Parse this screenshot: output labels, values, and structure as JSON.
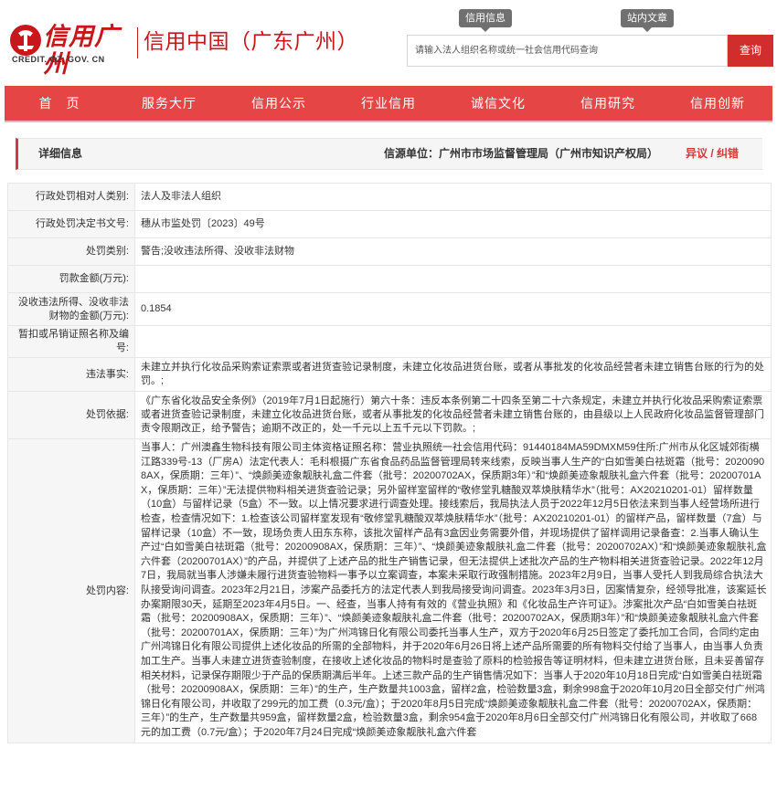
{
  "header": {
    "logo_cn": "信用广州",
    "logo_en": "CREDIT. GZ. GOV. CN",
    "site_title": "信用中国（广东广州）",
    "top_links": [
      "信用信息",
      "站内文章"
    ],
    "search": {
      "placeholder": "请输入法人组织名称或统一社会信用代码查询",
      "button_label": "查询"
    }
  },
  "nav": {
    "items": [
      "首　页",
      "服务大厅",
      "信用公示",
      "行业信用",
      "诚信文化",
      "信用研究",
      "信用创新"
    ]
  },
  "info_bar": {
    "title": "详细信息",
    "source_label": "信源单位：",
    "source_value": "广州市市场监督管理局（广州市知识产权局）",
    "error_link": "异议 / 纠错"
  },
  "colors": {
    "brand_red": "#c8161d",
    "nav_red": "#e64545",
    "search_btn": "#d12d2d",
    "gray_btn": "#707070"
  },
  "details": [
    {
      "label": "行政处罚相对人类别:",
      "value": "法人及非法人组织"
    },
    {
      "label": "行政处罚决定书文号:",
      "value": "穗从市监处罚〔2023〕49号"
    },
    {
      "label": "处罚类别:",
      "value": "警告;没收违法所得、没收非法财物"
    },
    {
      "label": "罚款金额(万元):",
      "value": ""
    },
    {
      "label": "没收违法所得、没收非法财物的金额(万元):",
      "value": "0.1854"
    },
    {
      "label": "暂扣或吊销证照名称及编号:",
      "value": ""
    },
    {
      "label": "违法事实:",
      "value": "未建立并执行化妆品采购索证索票或者进货查验记录制度，未建立化妆品进货台账，或者从事批发的化妆品经营者未建立销售台账的行为的处罚。;"
    },
    {
      "label": "处罚依据:",
      "value": "《广东省化妆品安全条例》（2019年7月1日起施行）第六十条：违反本条例第二十四条至第二十六条规定，未建立并执行化妆品采购索证索票或者进货查验记录制度，未建立化妆品进货台账，或者从事批发的化妆品经营者未建立销售台账的，由县级以上人民政府化妆品监督管理部门责令限期改正，给予警告；逾期不改正的，处一千元以上五千元以下罚款。;"
    },
    {
      "label": "处罚内容:",
      "value": "当事人：广州澳鑫生物科技有限公司主体资格证照名称：营业执照统一社会信用代码：91440184MA59DMXM59住所:广州市从化区城郊街横江路339号-13（厂房A）法定代表人：毛科根摄广东省食品药品监督管理局转来线索，反映当事人生产的“白如雪美白祛斑霜（批号：20200908AX，保质期：三年）”、“焕颜美迹象靓肤礼盒二件套（批号：20200702AX，保质期3年）”和“焕颜美迹象靓肤礼盒六件套（批号：20200701AX，保质期：三年）”无法提供物料相关进货查验记录；另外留样室留样的“敬修堂乳糖酸双萃焕肤精华水”（批号：AX20210201-01）留样数量（10盒）与留样记录（5盒）不一致。以上情况要求进行调查处理。接线索后，我局执法人员于2022年12月5日依法来到当事人经营场所进行检查，检查情况如下：1.检查该公司留样室发现有“敬修堂乳糖酸双萃焕肤精华水”（批号：AX20210201-01）的留样产品，留样数量（7盒）与留样记录（10盒）不一致，现场负责人田东东称，该批次留样产品有3盒因业务需要外借，并现场提供了留样调用记录备查：2.当事人确认生产过“白如雪美白祛斑霜（批号：20200908AX，保质期：三年）”、“焕颜美迹象靓肤礼盒二件套（批号：20200702AX）”和“焕颜美迹象靓肤礼盒六件套（20200701AX）”的产品，并提供了上述产品的批生产销售记录，但无法提供上述批次产品的生产物料相关进货查验记录。2022年12月7日，我局就当事人涉嫌未履行进货查验物料一事予以立案调查，本案未采取行政强制措施。2023年2月9日，当事人受托人到我局综合执法大队接受询问调查。2023年2月21日，涉案产品委托方的法定代表人到我局接受询问调查。2023年3月3日，因案情复杂，经领导批准，该案延长办案期限30天，延期至2023年4月5日。一、经查，当事人持有有效的《营业执照》和《化妆品生产许可证》。涉案批次产品“白如雪美白祛斑霜（批号：20200908AX，保质期：三年）”、“焕颜美迹象靓肤礼盒二件套（批号：20200702AX，保质期3年）”和“焕颜美迹象靓肤礼盒六件套（批号：20200701AX，保质期：三年）”为广州鸿锦日化有限公司委托当事人生产，双方于2020年6月25日签定了委托加工合同，合同约定由广州鸿锦日化有限公司提供上述化妆品的所需的全部物料，并于2020年6月26日将上述产品所需要的所有物料交付给了当事人，由当事人负责加工生产。当事人未建立进货查验制度，在接收上述化妆品的物料时是查验了原料的检验报告等证明材料，但未建立进货台账，且未妥善留存相关材料，记录保存期限少于产品的保质期满后半年。上述三款产品的生产销售情况如下：当事人于2020年10月18日完成“白如雪美白祛斑霜（批号：20200908AX，保质期：三年）”的生产，生产数量共1003盒，留样2盒，检验数量3盒，剩余998盒于2020年10月20日全部交付广州鸿锦日化有限公司，并收取了299元的加工费（0.3元/盒）；于2020年8月5日完成“焕颜美迹象靓肤礼盒二件套（批号：20200702AX，保质期：三年）”的生产，生产数量共959盒，留样数量2盒，检验数量3盒，剩余954盒于2020年8月6日全部交付广州鸿锦日化有限公司，并收取了668元的加工费（0.7元/盒）；于2020年7月24日完成“焕颜美迹象靓肤礼盒六件套"
    }
  ]
}
